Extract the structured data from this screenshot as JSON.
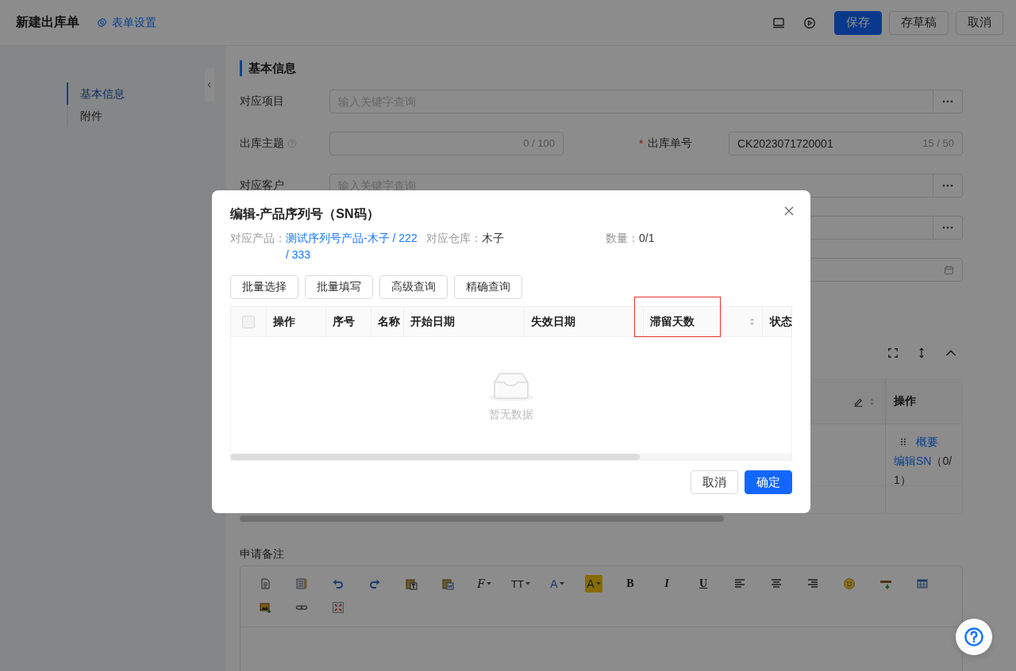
{
  "header": {
    "title": "新建出库单",
    "settings_link": "表单设置",
    "buttons": [
      {
        "label": "保存",
        "kind": "primary"
      },
      {
        "label": "存草稿",
        "kind": "default"
      },
      {
        "label": "取消",
        "kind": "default"
      }
    ]
  },
  "sidebar": {
    "items": [
      {
        "label": "基本信息",
        "selected": true
      },
      {
        "label": "附件",
        "selected": false
      }
    ]
  },
  "form": {
    "section_title": "基本信息",
    "rows": [
      [
        {
          "label": "对应项目",
          "kind": "lookup",
          "placeholder": "输入关键字查询"
        }
      ],
      [
        {
          "label": "出库主题",
          "help": true,
          "kind": "text",
          "counter": "0 / 100"
        },
        {
          "label": "出库单号",
          "required_mark": "*",
          "kind": "text",
          "value": "CK2023071720001",
          "counter": "15 / 50"
        }
      ],
      [
        {
          "label": "对应客户",
          "kind": "lookup",
          "placeholder": "输入关键字查询"
        }
      ],
      [
        {
          "kind": "lookup"
        }
      ],
      [
        {
          "kind": "date"
        }
      ]
    ]
  },
  "table": {
    "columns": [
      {
        "editable": true,
        "sortable": true
      },
      {
        "label": "操作"
      }
    ],
    "rows": [
      {
        "actions": [
          "概要",
          "编辑SN"
        ],
        "count": "（0/1）"
      }
    ]
  },
  "remarks": {
    "label": "申请备注",
    "glyphs": [
      "F",
      "TT",
      "A",
      "A",
      "B",
      "I",
      "U"
    ]
  },
  "dialog": {
    "title": "编辑-产品序列号（SN码）",
    "info": [
      {
        "label": "对应产品：",
        "value": "测试序列号产品-木子 / 222 / 333",
        "kind": "link"
      },
      {
        "label": "对应仓库：",
        "value": "木子",
        "kind": "text"
      },
      {
        "label": "数量：",
        "value": "0/1",
        "kind": "text"
      }
    ],
    "toolbar": [
      "批量选择",
      "批量填写",
      "高级查询",
      "精确查询"
    ],
    "table": {
      "columns": [
        {
          "kind": "checkbox",
          "checked": false
        },
        {
          "kind": "text",
          "label": "操作"
        },
        {
          "kind": "text",
          "label": "序号"
        },
        {
          "kind": "text",
          "label": "名称"
        },
        {
          "kind": "text",
          "label": "开始日期"
        },
        {
          "kind": "text",
          "label": "失效日期"
        },
        {
          "kind": "text",
          "label": "滞留天数",
          "sortable": true,
          "highlighted": true
        },
        {
          "kind": "text",
          "label": "状态"
        }
      ],
      "empty_text": "暂无数据"
    },
    "buttons": [
      {
        "label": "取消",
        "kind": "default"
      },
      {
        "label": "确定",
        "kind": "primary"
      }
    ]
  }
}
